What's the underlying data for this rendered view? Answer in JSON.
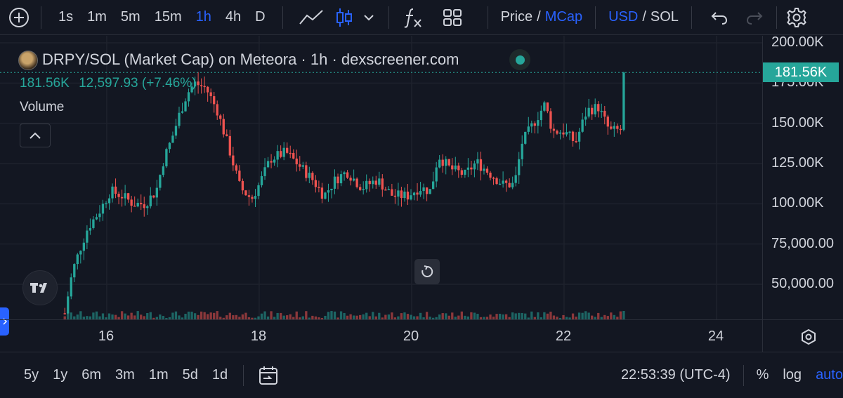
{
  "toolbar": {
    "timeframes": [
      "1s",
      "1m",
      "5m",
      "15m",
      "1h",
      "4h",
      "D"
    ],
    "active_timeframe": "1h",
    "price_label": "Price",
    "slash": "/",
    "mcap_label": "MCap",
    "usd_label": "USD",
    "sol_label": "SOL"
  },
  "legend": {
    "title": "DRPY/SOL (Market Cap) on Meteora · 1h · dexscreener.com",
    "last_value": "181.56K",
    "change_value": "12,597.93 (+7.46%)",
    "volume_label": "Volume"
  },
  "price_axis": {
    "labels": [
      "200.00K",
      "175.00K",
      "150.00K",
      "125.00K",
      "100.00K",
      "75,000.00",
      "50,000.00"
    ],
    "current_price": "181.56K"
  },
  "time_axis": {
    "labels": [
      "16",
      "18",
      "20",
      "22",
      "24"
    ]
  },
  "bottom_bar": {
    "ranges": [
      "5y",
      "1y",
      "6m",
      "3m",
      "1m",
      "5d",
      "1d"
    ],
    "clock": "22:53:39 (UTC-4)",
    "percent_label": "%",
    "log_label": "log",
    "auto_label": "auto"
  },
  "colors": {
    "background": "#131722",
    "up": "#26a69a",
    "down": "#ef5350",
    "accent": "#2962ff"
  },
  "icons": {
    "add": "plus-circle-icon",
    "line_chart": "line-chart-icon",
    "candles": "candlestick-icon",
    "indicators": "fx-icon",
    "layouts": "grid-icon",
    "undo": "undo-icon",
    "redo": "redo-icon",
    "settings": "gear-icon",
    "logo": "tradingview-logo",
    "reset": "reset-icon",
    "axis_settings": "hexagon-settings-icon",
    "date_range": "calendar-goto-icon"
  },
  "chart_data": {
    "type": "candlestick",
    "x_unit": "day (hourly candles)",
    "y_unit": "market cap (USD)",
    "ylim": [
      35000,
      205000
    ],
    "xlim": [
      14.6,
      24.6
    ],
    "anchors": [
      [
        15.45,
        32000
      ],
      [
        15.55,
        58000
      ],
      [
        15.65,
        72000
      ],
      [
        15.75,
        85000
      ],
      [
        15.9,
        95000
      ],
      [
        16.05,
        108000
      ],
      [
        16.2,
        105000
      ],
      [
        16.35,
        100000
      ],
      [
        16.5,
        100000
      ],
      [
        16.65,
        108000
      ],
      [
        16.75,
        128000
      ],
      [
        16.85,
        140000
      ],
      [
        16.95,
        155000
      ],
      [
        17.05,
        168000
      ],
      [
        17.15,
        175000
      ],
      [
        17.3,
        172000
      ],
      [
        17.45,
        158000
      ],
      [
        17.6,
        135000
      ],
      [
        17.75,
        110000
      ],
      [
        17.9,
        103000
      ],
      [
        18.0,
        112000
      ],
      [
        18.15,
        128000
      ],
      [
        18.35,
        132000
      ],
      [
        18.5,
        125000
      ],
      [
        18.7,
        115000
      ],
      [
        18.85,
        105000
      ],
      [
        19.0,
        115000
      ],
      [
        19.15,
        120000
      ],
      [
        19.35,
        110000
      ],
      [
        19.55,
        115000
      ],
      [
        19.75,
        105000
      ],
      [
        19.95,
        105000
      ],
      [
        20.1,
        110000
      ],
      [
        20.25,
        108000
      ],
      [
        20.35,
        130000
      ],
      [
        20.5,
        122000
      ],
      [
        20.7,
        118000
      ],
      [
        20.85,
        126000
      ],
      [
        21.0,
        120000
      ],
      [
        21.2,
        112000
      ],
      [
        21.35,
        112000
      ],
      [
        21.45,
        138000
      ],
      [
        21.6,
        150000
      ],
      [
        21.75,
        162000
      ],
      [
        21.85,
        145000
      ],
      [
        22.0,
        145000
      ],
      [
        22.15,
        138000
      ],
      [
        22.3,
        158000
      ],
      [
        22.45,
        160000
      ],
      [
        22.6,
        145000
      ],
      [
        22.75,
        146000
      ],
      [
        22.82,
        181560
      ]
    ]
  }
}
